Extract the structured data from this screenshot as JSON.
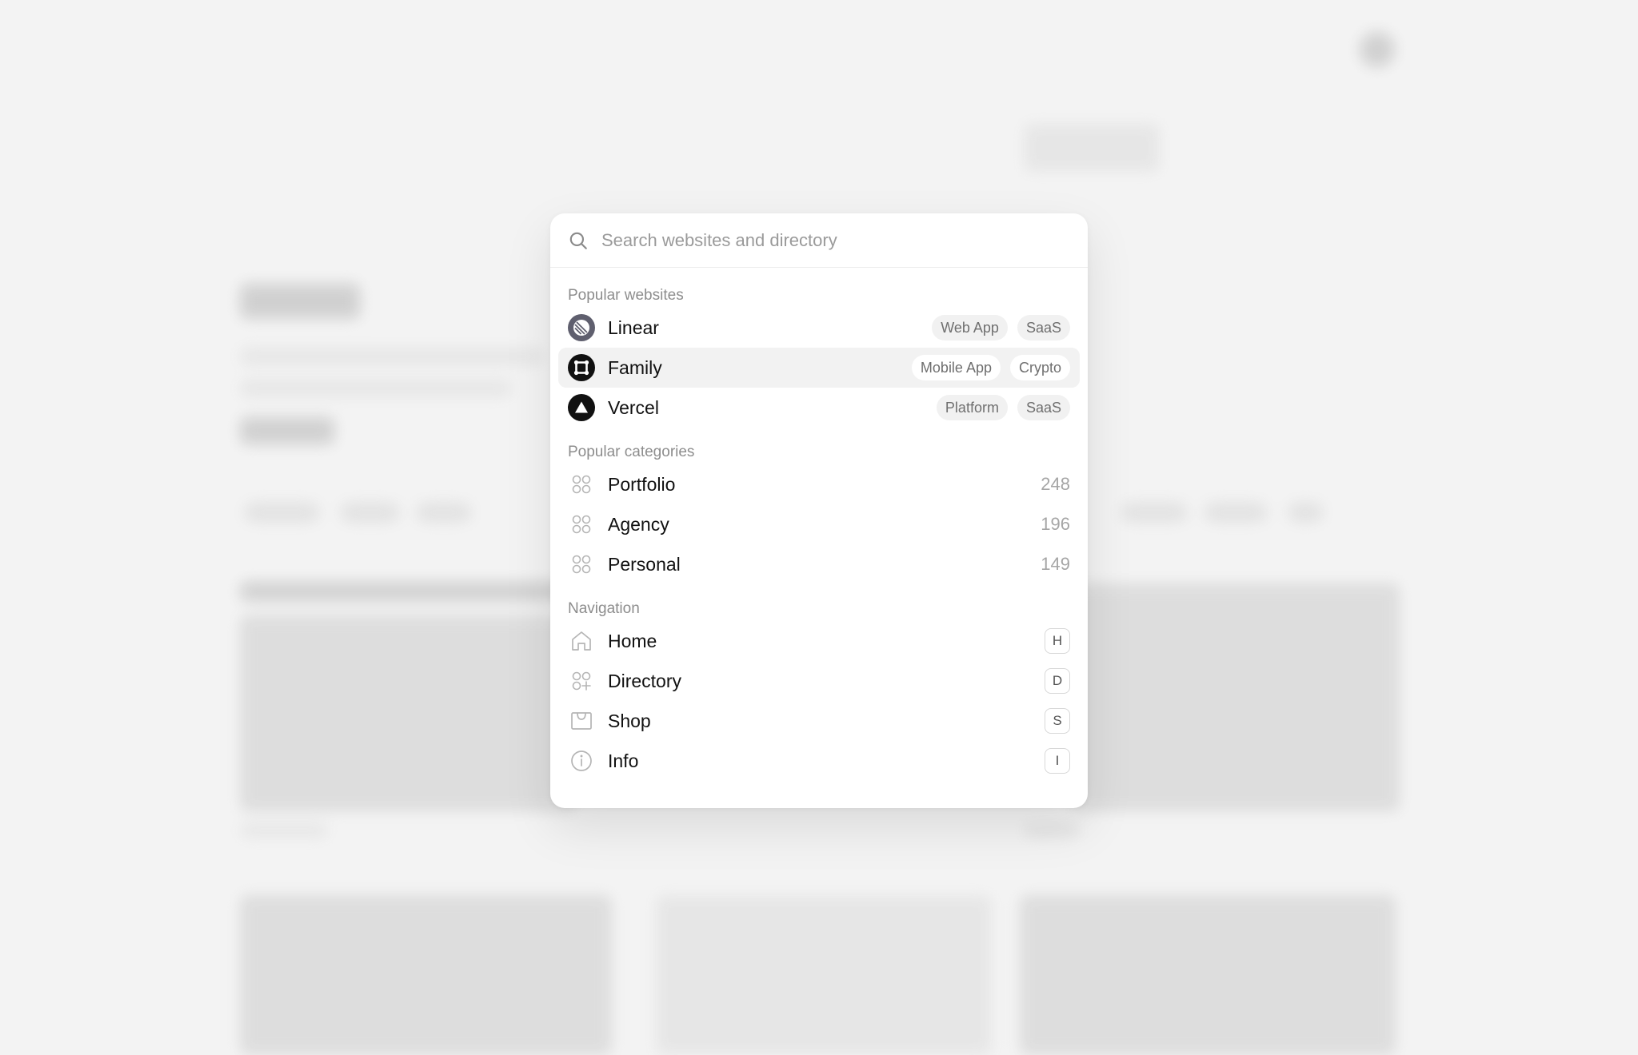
{
  "search": {
    "placeholder": "Search websites and directory"
  },
  "sections": {
    "websites": {
      "label": "Popular websites",
      "items": [
        {
          "name": "Linear",
          "tags": [
            "Web App",
            "SaaS"
          ],
          "icon": "linear-logo-icon"
        },
        {
          "name": "Family",
          "tags": [
            "Mobile App",
            "Crypto"
          ],
          "icon": "family-logo-icon",
          "active": true
        },
        {
          "name": "Vercel",
          "tags": [
            "Platform",
            "SaaS"
          ],
          "icon": "vercel-logo-icon"
        }
      ]
    },
    "categories": {
      "label": "Popular categories",
      "items": [
        {
          "name": "Portfolio",
          "count": "248",
          "icon": "grid-dots-icon"
        },
        {
          "name": "Agency",
          "count": "196",
          "icon": "grid-dots-icon"
        },
        {
          "name": "Personal",
          "count": "149",
          "icon": "grid-dots-icon"
        }
      ]
    },
    "navigation": {
      "label": "Navigation",
      "items": [
        {
          "name": "Home",
          "key": "H",
          "icon": "home-icon"
        },
        {
          "name": "Directory",
          "key": "D",
          "icon": "directory-icon"
        },
        {
          "name": "Shop",
          "key": "S",
          "icon": "shop-icon"
        },
        {
          "name": "Info",
          "key": "I",
          "icon": "info-icon"
        }
      ]
    }
  },
  "colors": {
    "accent": "#111111",
    "muted": "#8d8d8d",
    "tag_bg": "#f1f1f1",
    "active_bg": "#f2f2f2"
  }
}
